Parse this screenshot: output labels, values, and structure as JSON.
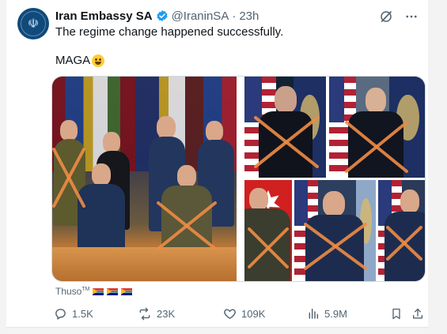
{
  "post": {
    "author_name": "Iran Embassy SA",
    "handle": "@IraninSA",
    "separator": "·",
    "time": "23h",
    "text_line1": "The regime change happened successfully.",
    "text_line2": "MAGA",
    "emoji": "grinning-face-emoji",
    "verified_badge": "verified-badge-icon",
    "media_credit": "Thuso",
    "media_credit_mark": "TM",
    "credit_flags": [
      "south-africa-flag",
      "south-africa-flag",
      "south-africa-flag"
    ]
  },
  "header_icons": [
    "grok-icon",
    "more-options-icon"
  ],
  "actions": {
    "replies": "1.5K",
    "reposts": "23K",
    "likes": "109K",
    "views": "5.9M"
  },
  "colors": {
    "verified": "#1d9bf0",
    "muted_text": "#536471",
    "cross_mark": "#ef8c45"
  }
}
